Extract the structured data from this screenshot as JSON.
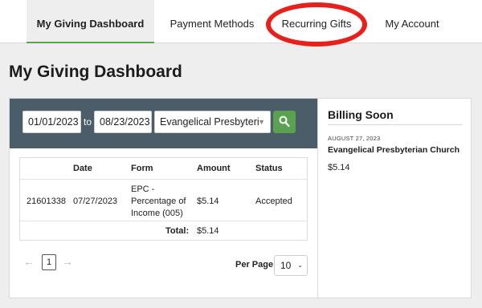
{
  "nav": {
    "tabs": [
      {
        "label": "My Giving Dashboard",
        "active": true
      },
      {
        "label": "Payment Methods",
        "active": false
      },
      {
        "label": "Recurring Gifts",
        "active": false
      },
      {
        "label": "My Account",
        "active": false
      }
    ],
    "highlight_color": "#e8201c",
    "active_color": "#5aa152"
  },
  "page_title": "My Giving Dashboard",
  "filters": {
    "start_date": "01/01/2023",
    "to_label": "to",
    "end_date": "08/23/2023",
    "organization": "Evangelical Presbyteri",
    "search_icon": "search-icon"
  },
  "table": {
    "headers": [
      "",
      "Date",
      "Form",
      "Amount",
      "Status"
    ],
    "rows": [
      {
        "id": "21601338",
        "date": "07/27/2023",
        "form_line1": "EPC -",
        "form_line2": "Percentage of",
        "form_line3": "Income (005)",
        "amount": "$5.14",
        "status": "Accepted"
      }
    ],
    "total_label": "Total:",
    "total_amount": "$5.14"
  },
  "pagination": {
    "prev_icon": "arrow-left-icon",
    "current_page": "1",
    "next_icon": "arrow-right-icon",
    "per_page_label": "Per Page:",
    "per_page_value": "10"
  },
  "billing": {
    "title": "Billing Soon",
    "date": "AUGUST 27, 2023",
    "church": "Evangelical Presbyterian Church",
    "amount": "$5.14"
  },
  "colors": {
    "filter_bar": "#4a5d69",
    "search_button": "#5aa152"
  }
}
